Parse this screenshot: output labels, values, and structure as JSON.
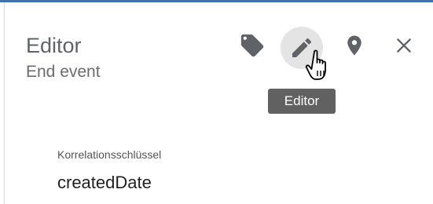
{
  "panel": {
    "title": "Editor",
    "subtitle": "End event"
  },
  "toolbar": {
    "buttons": [
      {
        "name": "tag",
        "icon": "tag-icon",
        "active": false
      },
      {
        "name": "editor",
        "icon": "pencil-icon",
        "active": true,
        "tooltip": "Editor"
      },
      {
        "name": "location",
        "icon": "location-pin-icon",
        "active": false
      },
      {
        "name": "close",
        "icon": "close-icon",
        "active": false
      }
    ],
    "tooltip": "Editor"
  },
  "field": {
    "label": "Korrelationsschlüssel",
    "value": "createdDate"
  },
  "colors": {
    "accent": "#3f6fae",
    "icon": "#5f6368",
    "active_bg": "#e4e4e4",
    "tooltip_bg": "#616161"
  }
}
